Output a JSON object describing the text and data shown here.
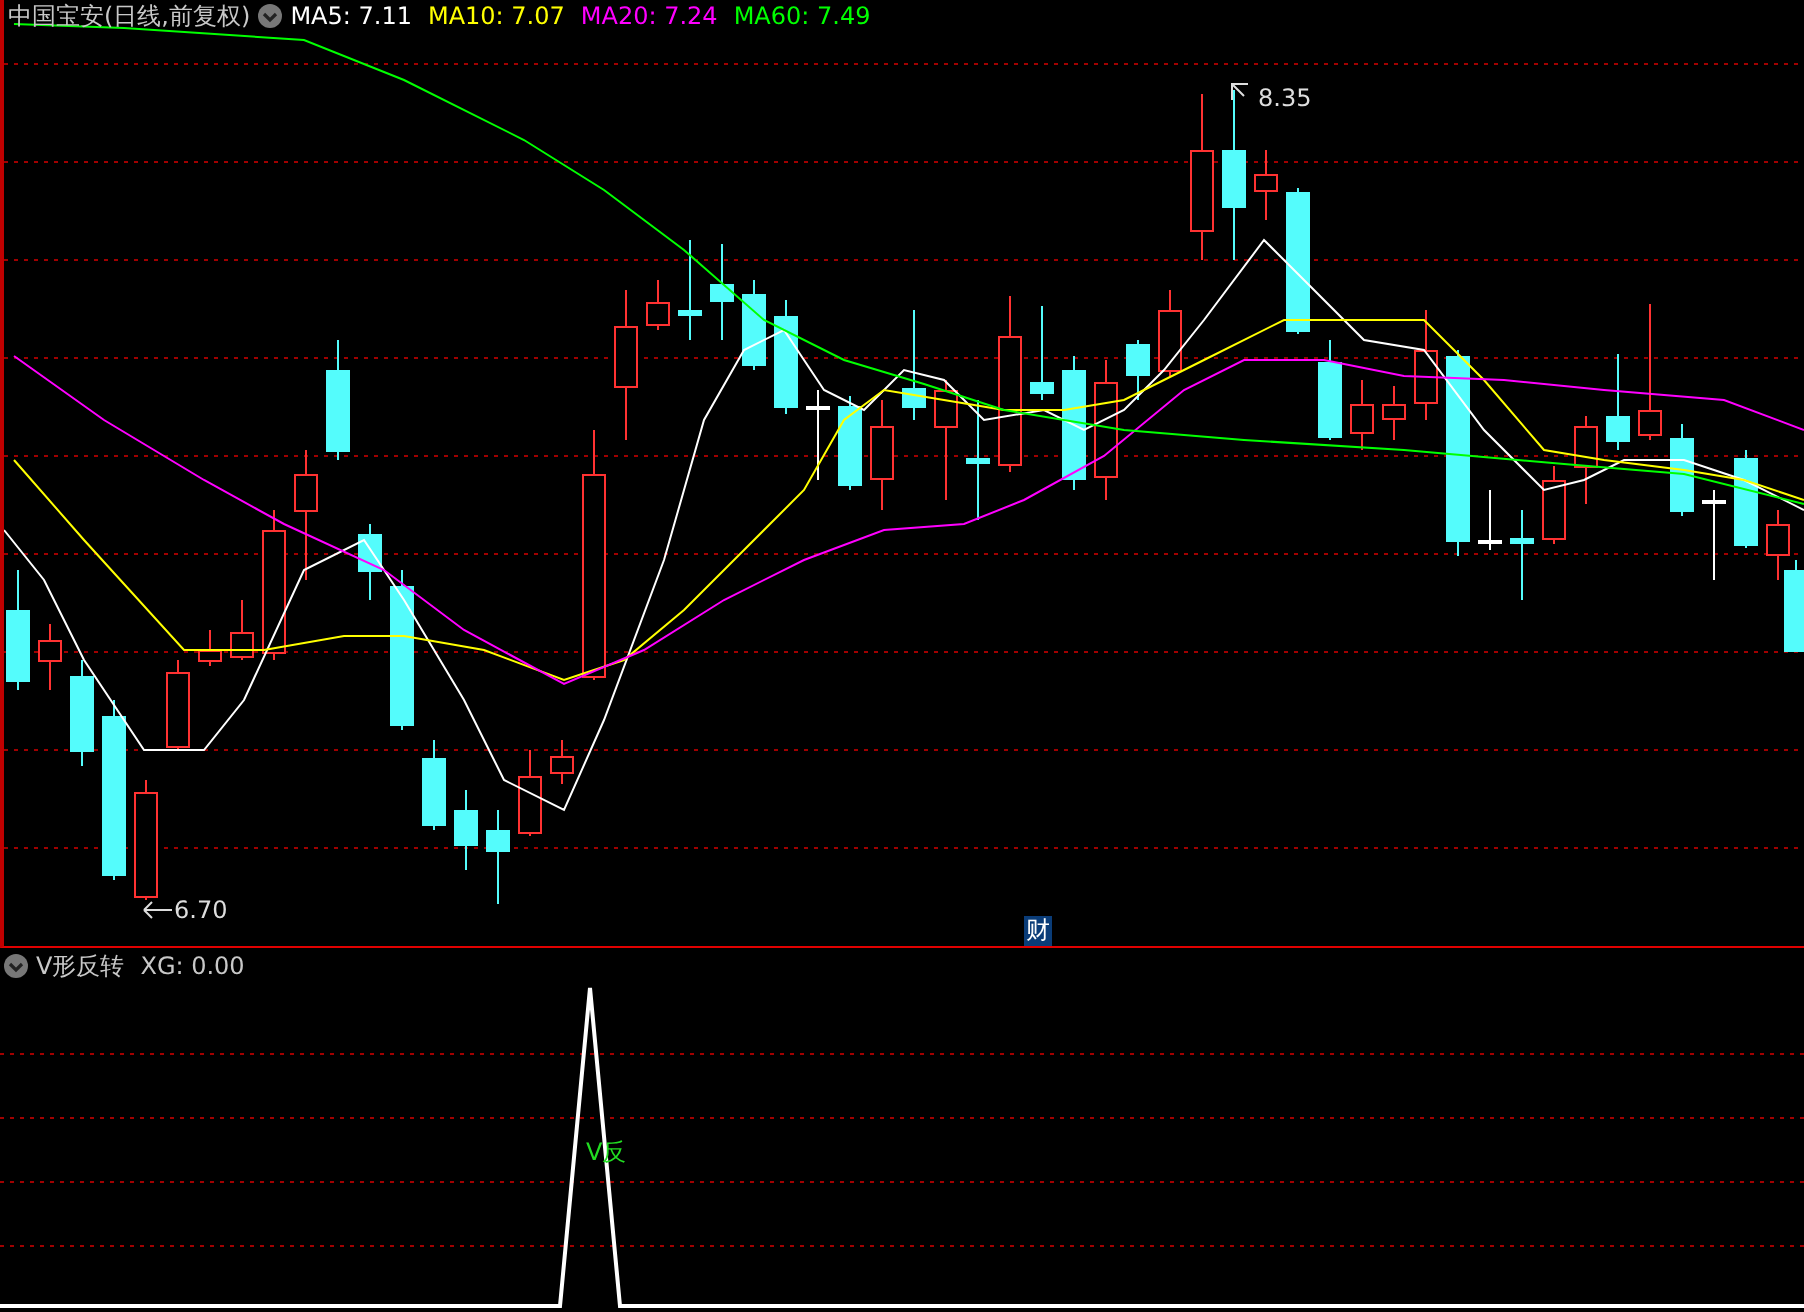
{
  "main_panel": {
    "title": "中国宝安(日线,前复权)",
    "indicators": [
      {
        "label": "MA5: 7.11",
        "color": "#ffffff"
      },
      {
        "label": "MA10: 7.07",
        "color": "#ffff00"
      },
      {
        "label": "MA20: 7.24",
        "color": "#ff00ff"
      },
      {
        "label": "MA60: 7.49",
        "color": "#00ff00"
      }
    ],
    "high_label": "8.35",
    "low_label": "6.70",
    "finance_badge": "财"
  },
  "sub_panel": {
    "title": "V形反转",
    "reading": "XG: 0.00",
    "signal_label": "V反"
  }
}
